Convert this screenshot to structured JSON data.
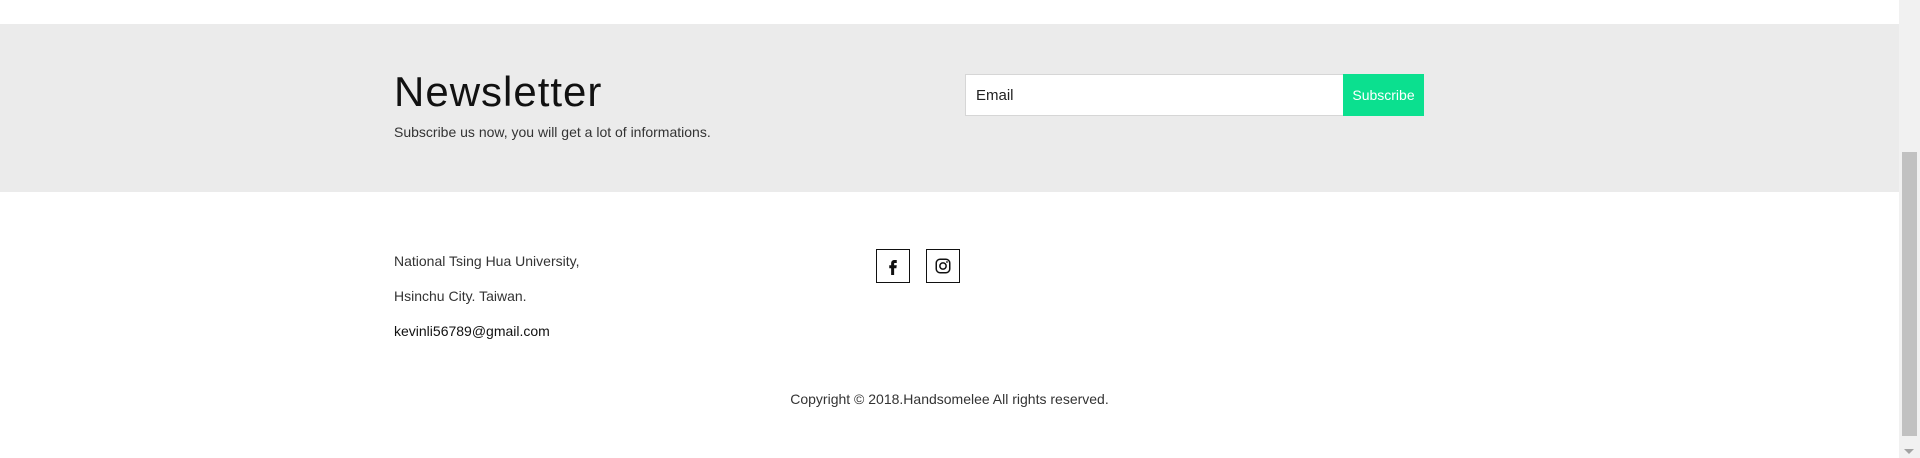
{
  "newsletter": {
    "title": "Newsletter",
    "subtitle": "Subscribe us now, you will get a lot of informations.",
    "email_placeholder": "Email",
    "email_value": "",
    "subscribe_label": "Subscribe"
  },
  "footer": {
    "address_line1": "National Tsing Hua University,",
    "address_line2": "Hsinchu City. Taiwan.",
    "email": "kevinli56789@gmail.com",
    "social": [
      {
        "name": "facebook",
        "icon": "facebook-icon"
      },
      {
        "name": "instagram",
        "icon": "instagram-icon"
      }
    ],
    "copyright": "Copyright © 2018.Handsomelee All rights reserved."
  },
  "colors": {
    "newsletter_bg": "#ebebeb",
    "accent": "#0be08f",
    "text": "#333333"
  }
}
